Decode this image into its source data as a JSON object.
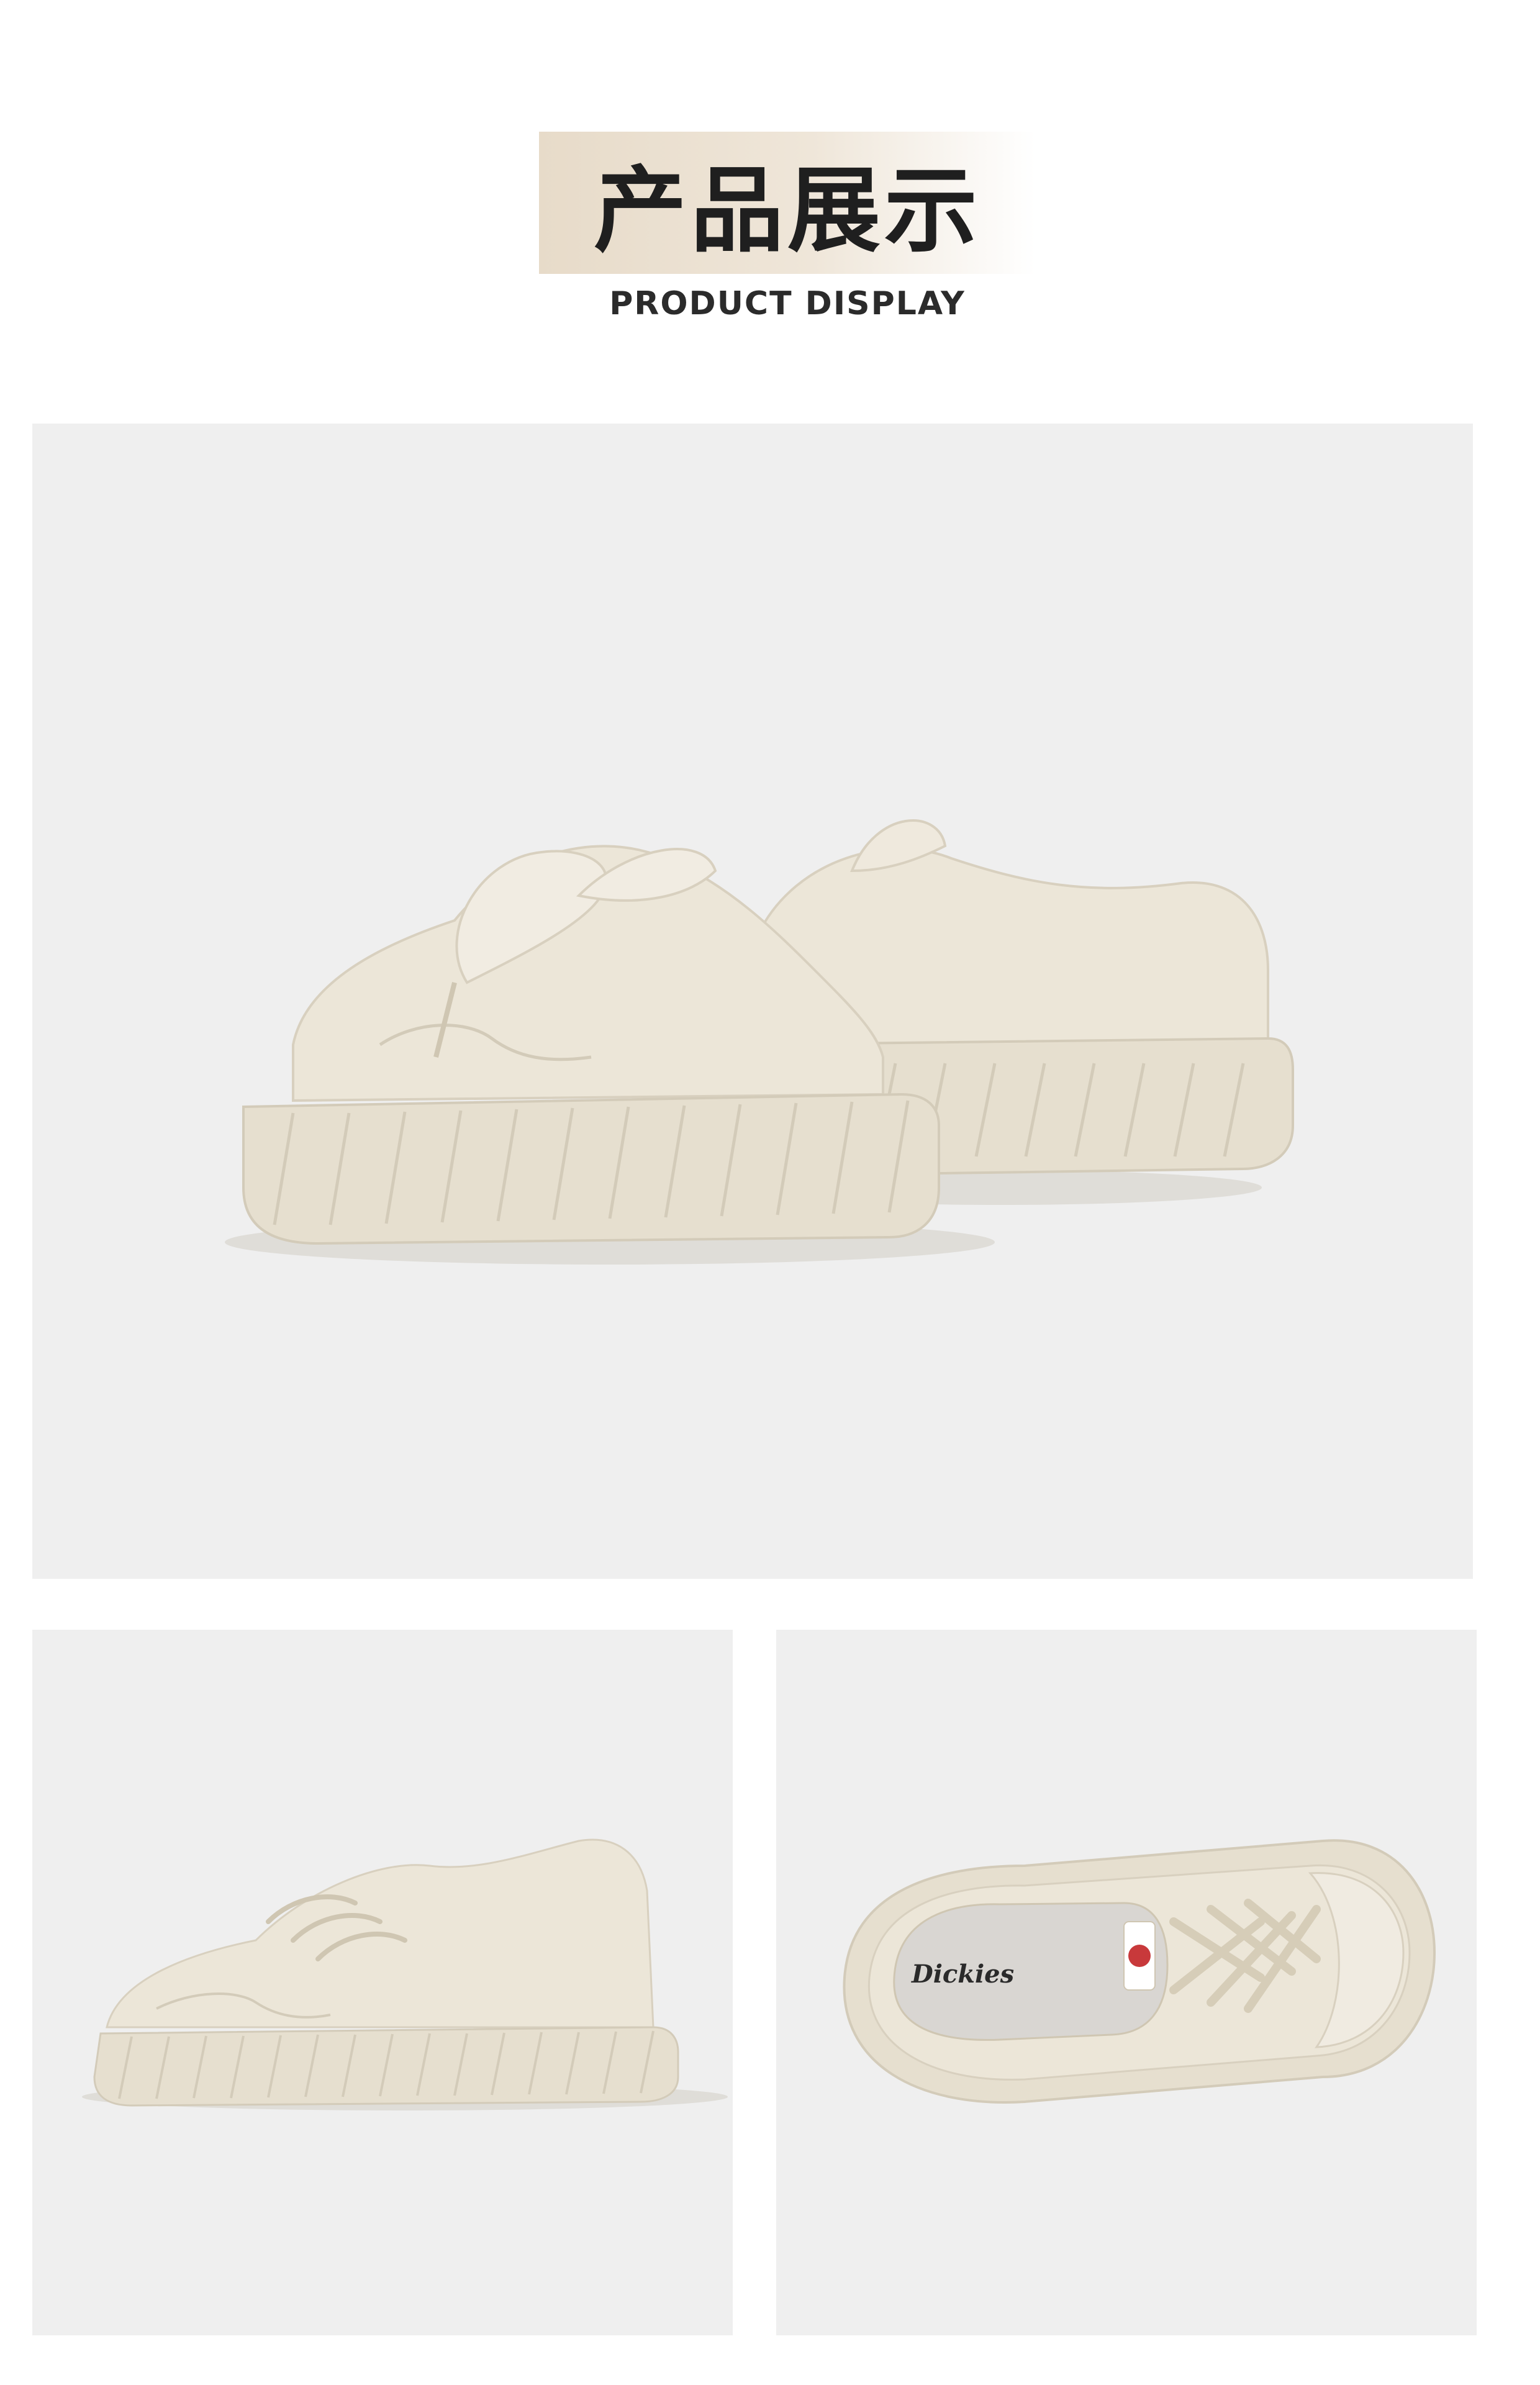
{
  "header": {
    "title_cn": "产品展示",
    "title_en": "PRODUCT DISPLAY"
  },
  "colors": {
    "header_band": "#e7dbc9",
    "panel_bg": "#efefef",
    "shoe_cream": "#ece6d8",
    "sole_cream": "#e6dfcf",
    "shadow": "#d9d6cf"
  },
  "images": {
    "hero": "pair-of-cream-canvas-sneakers-rear-view",
    "side": "cream-canvas-sneaker-side-view",
    "top": "cream-canvas-sneaker-top-view"
  },
  "brand": {
    "insole_logo": "Dickies"
  }
}
